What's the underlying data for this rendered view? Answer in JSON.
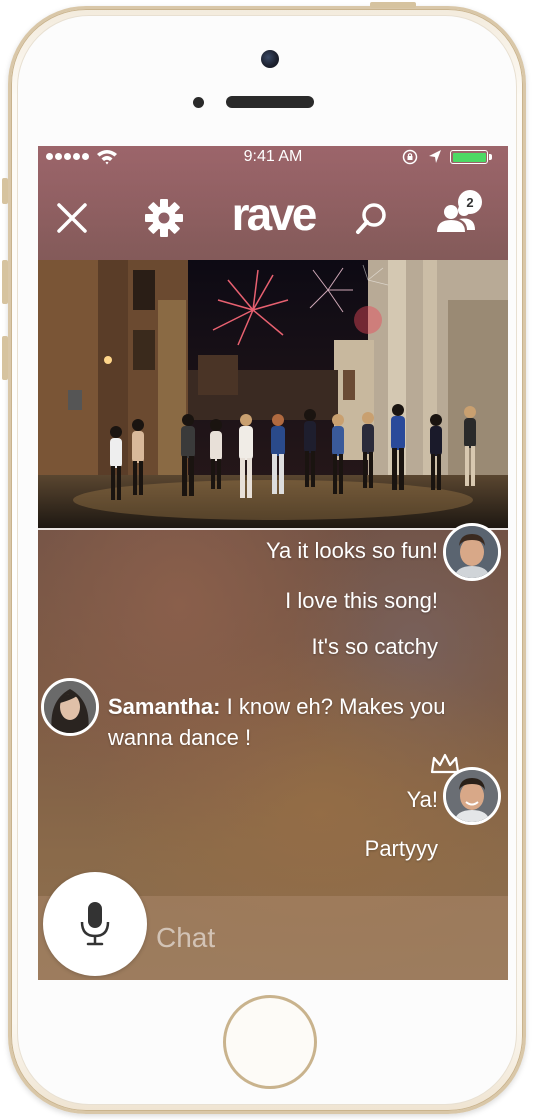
{
  "status_bar": {
    "time": "9:41 AM"
  },
  "header": {
    "logo_text": "rave",
    "users_badge": "2"
  },
  "messages": [
    {
      "text": "Ya it looks so fun!"
    },
    {
      "text": "I love this song!"
    },
    {
      "text": "It's so catchy"
    },
    {
      "sender": "Samantha:",
      "text": "I know eh? Makes you wanna dance !"
    },
    {
      "text": "Ya!"
    },
    {
      "text": "Partyyy"
    }
  ],
  "composer": {
    "placeholder": "Chat"
  },
  "colors": {
    "battery": "#4cd964",
    "accent": "#ffffff"
  },
  "icons": [
    "close-icon",
    "gear-icon",
    "search-icon",
    "users-icon",
    "microphone-icon",
    "crown-icon"
  ]
}
